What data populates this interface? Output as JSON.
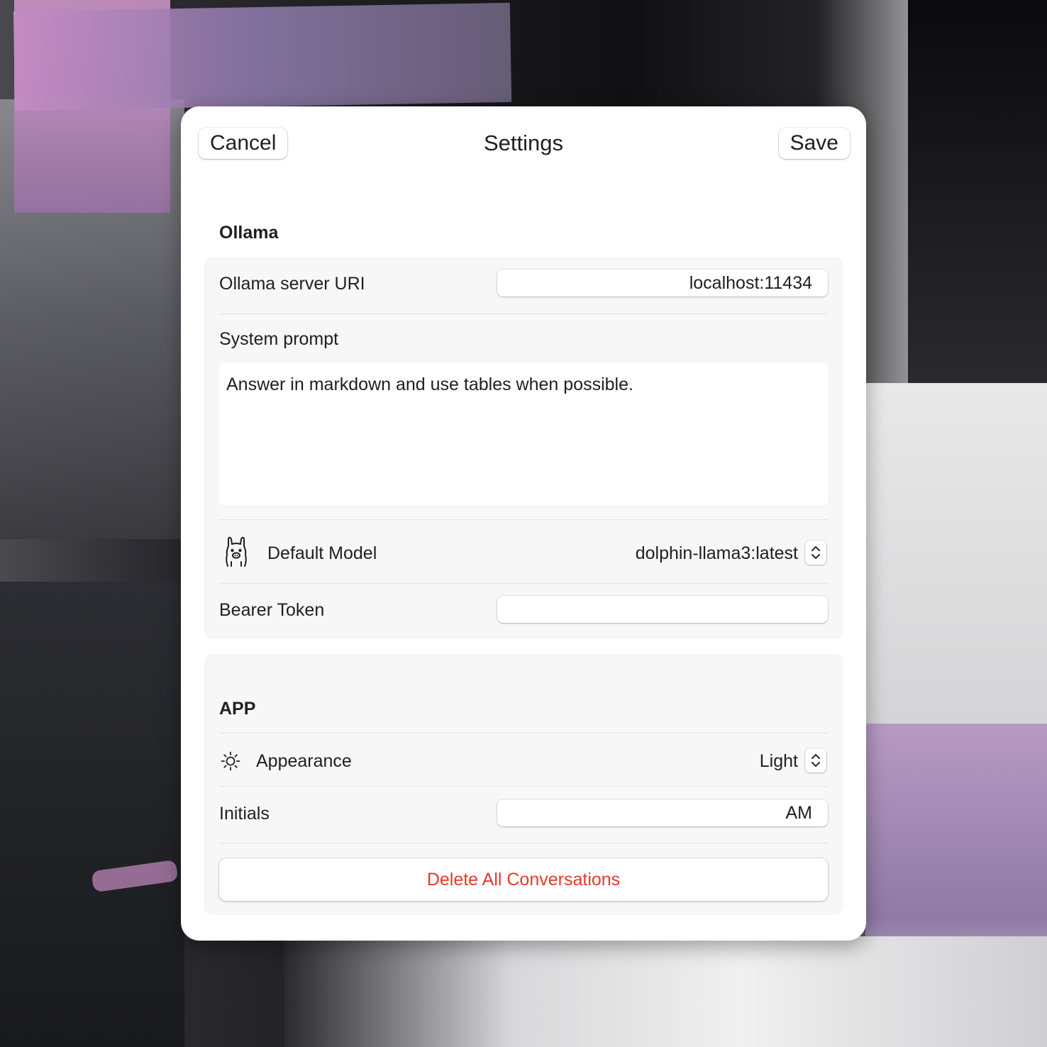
{
  "header": {
    "cancel_label": "Cancel",
    "title": "Settings",
    "save_label": "Save"
  },
  "ollama": {
    "section_title": "Ollama",
    "server_uri_label": "Ollama server URI",
    "server_uri_value": "localhost:11434",
    "system_prompt_label": "System prompt",
    "system_prompt_value": "Answer in markdown and use tables when possible.",
    "default_model_icon": "llama-icon",
    "default_model_label": "Default Model",
    "default_model_value": "dolphin-llama3:latest",
    "bearer_token_label": "Bearer Token",
    "bearer_token_value": ""
  },
  "app": {
    "section_title": "APP",
    "appearance_icon": "sun-icon",
    "appearance_label": "Appearance",
    "appearance_value": "Light",
    "initials_label": "Initials",
    "initials_value": "AM",
    "delete_label": "Delete All Conversations",
    "delete_color": "#e5392c"
  }
}
